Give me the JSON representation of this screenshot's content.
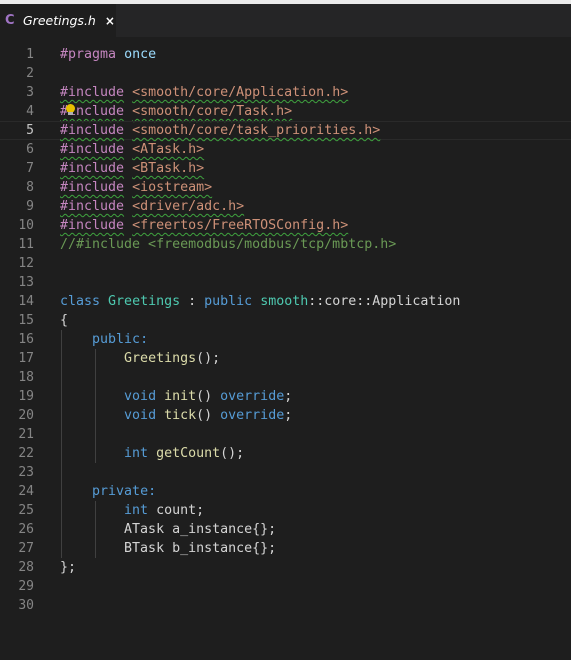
{
  "tab": {
    "lang_icon": "C",
    "title": "Greetings.h",
    "close": "×"
  },
  "current_line": 5,
  "lines": [
    {
      "n": "1",
      "tokens": [
        {
          "t": "#pragma",
          "c": "pp"
        },
        {
          "t": " "
        },
        {
          "t": "once",
          "c": "id"
        }
      ]
    },
    {
      "n": "2",
      "tokens": []
    },
    {
      "n": "3",
      "tokens": [
        {
          "t": "#include",
          "c": "pp",
          "sq": true
        },
        {
          "t": " "
        },
        {
          "t": "<smooth/core/Application.h>",
          "c": "str",
          "sq": true
        }
      ]
    },
    {
      "n": "4",
      "tokens": [
        {
          "t": "#include",
          "c": "pp",
          "sq": true
        },
        {
          "t": " "
        },
        {
          "t": "<smooth/core/Task.h>",
          "c": "str",
          "sq": true
        }
      ],
      "bulb": true
    },
    {
      "n": "5",
      "tokens": [
        {
          "t": "#include",
          "c": "pp",
          "sq": true
        },
        {
          "t": " "
        },
        {
          "t": "<smooth/core/task_priorities.h>",
          "c": "str",
          "sq": true
        }
      ]
    },
    {
      "n": "6",
      "tokens": [
        {
          "t": "#include",
          "c": "pp",
          "sq": true
        },
        {
          "t": " "
        },
        {
          "t": "<ATask.h>",
          "c": "str",
          "sq": true
        }
      ]
    },
    {
      "n": "7",
      "tokens": [
        {
          "t": "#include",
          "c": "pp",
          "sq": true
        },
        {
          "t": " "
        },
        {
          "t": "<BTask.h>",
          "c": "str",
          "sq": true
        }
      ]
    },
    {
      "n": "8",
      "tokens": [
        {
          "t": "#include",
          "c": "pp",
          "sq": true
        },
        {
          "t": " "
        },
        {
          "t": "<iostream>",
          "c": "str",
          "sq": true
        }
      ]
    },
    {
      "n": "9",
      "tokens": [
        {
          "t": "#include",
          "c": "pp",
          "sq": true
        },
        {
          "t": " "
        },
        {
          "t": "<driver/adc.h>",
          "c": "str",
          "sq": true
        }
      ]
    },
    {
      "n": "10",
      "tokens": [
        {
          "t": "#include",
          "c": "pp",
          "sq": true
        },
        {
          "t": " "
        },
        {
          "t": "<freertos/FreeRTOSConfig.h>",
          "c": "str",
          "sq": true
        }
      ]
    },
    {
      "n": "11",
      "tokens": [
        {
          "t": "//#include <freemodbus/modbus/tcp/mbtcp.h>",
          "c": "cm"
        }
      ]
    },
    {
      "n": "12",
      "tokens": []
    },
    {
      "n": "13",
      "tokens": []
    },
    {
      "n": "14",
      "tokens": [
        {
          "t": "class",
          "c": "kw"
        },
        {
          "t": " "
        },
        {
          "t": "Greetings",
          "c": "ty"
        },
        {
          "t": " : "
        },
        {
          "t": "public",
          "c": "kw"
        },
        {
          "t": " "
        },
        {
          "t": "smooth",
          "c": "ty"
        },
        {
          "t": "::core::Application"
        }
      ]
    },
    {
      "n": "15",
      "tokens": [
        {
          "t": "{"
        }
      ]
    },
    {
      "n": "16",
      "tokens": [
        {
          "t": "    "
        },
        {
          "t": "public:",
          "c": "kw"
        }
      ]
    },
    {
      "n": "17",
      "tokens": [
        {
          "t": "        "
        },
        {
          "t": "Greetings",
          "c": "fn"
        },
        {
          "t": "();"
        }
      ]
    },
    {
      "n": "18",
      "tokens": []
    },
    {
      "n": "19",
      "tokens": [
        {
          "t": "        "
        },
        {
          "t": "void",
          "c": "kw"
        },
        {
          "t": " "
        },
        {
          "t": "init",
          "c": "fn"
        },
        {
          "t": "() "
        },
        {
          "t": "override",
          "c": "kw"
        },
        {
          "t": ";"
        }
      ]
    },
    {
      "n": "20",
      "tokens": [
        {
          "t": "        "
        },
        {
          "t": "void",
          "c": "kw"
        },
        {
          "t": " "
        },
        {
          "t": "tick",
          "c": "fn"
        },
        {
          "t": "() "
        },
        {
          "t": "override",
          "c": "kw"
        },
        {
          "t": ";"
        }
      ]
    },
    {
      "n": "21",
      "tokens": []
    },
    {
      "n": "22",
      "tokens": [
        {
          "t": "        "
        },
        {
          "t": "int",
          "c": "kw"
        },
        {
          "t": " "
        },
        {
          "t": "getCount",
          "c": "fn"
        },
        {
          "t": "();"
        }
      ]
    },
    {
      "n": "23",
      "tokens": []
    },
    {
      "n": "24",
      "tokens": [
        {
          "t": "    "
        },
        {
          "t": "private:",
          "c": "kw"
        }
      ]
    },
    {
      "n": "25",
      "tokens": [
        {
          "t": "        "
        },
        {
          "t": "int",
          "c": "kw"
        },
        {
          "t": " count;"
        }
      ]
    },
    {
      "n": "26",
      "tokens": [
        {
          "t": "        ATask a_instance{};"
        }
      ]
    },
    {
      "n": "27",
      "tokens": [
        {
          "t": "        BTask b_instance{};"
        }
      ]
    },
    {
      "n": "28",
      "tokens": [
        {
          "t": "};"
        }
      ]
    },
    {
      "n": "29",
      "tokens": []
    },
    {
      "n": "30",
      "tokens": []
    }
  ]
}
